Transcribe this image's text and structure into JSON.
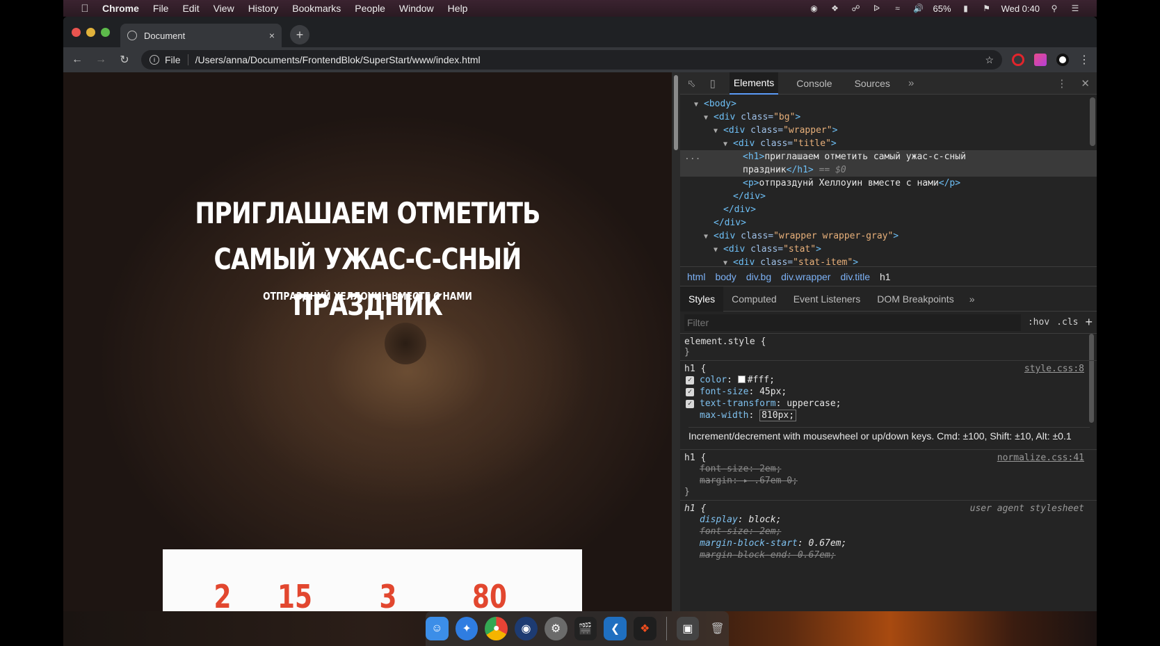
{
  "menubar": {
    "items": [
      "Chrome",
      "File",
      "Edit",
      "View",
      "History",
      "Bookmarks",
      "People",
      "Window",
      "Help"
    ],
    "battery": "65%",
    "clock": "Wed 0:40"
  },
  "browser": {
    "tab_title": "Document",
    "tab_close": "×",
    "new_tab": "+",
    "url_scheme": "File",
    "url_path": "/Users/anna/Documents/FrontendBlok/SuperStart/www/index.html"
  },
  "page": {
    "title": "ПРИГЛАШАЕМ ОТМЕТИТЬ САМЫЙ УЖАС-С-СНЫЙ ПРАЗДНИК",
    "subtitle": "ОТПРАЗДНУЙ ХЕЛЛОУИН ВМЕСТЕ С НАМИ",
    "stats": [
      "2",
      "15",
      "3",
      "80"
    ]
  },
  "devtools": {
    "tabs": [
      "Elements",
      "Console",
      "Sources"
    ],
    "more": "»",
    "dom": {
      "l1": "<body>",
      "l2_tag": "<div ",
      "l2_attr": "class=",
      "l2_val": "\"bg\"",
      "l2_end": ">",
      "l3_val": "\"wrapper\"",
      "l4_val": "\"title\"",
      "l5a": "<h1>",
      "l5b": "приглашаем отметить самый ужас-с-сный",
      "l6a": "праздник",
      "l6b": "</h1>",
      "l6c": " == $0",
      "l7a": "<p>",
      "l7b": "отпраздунй Хеллоуин вместе с нами",
      "l7c": "</p>",
      "l8": "</div>",
      "l9": "</div>",
      "l10": "</div>",
      "l11_val": "\"wrapper wrapper-gray\"",
      "l12_val": "\"stat\"",
      "l13_val": "\"stat-item\"",
      "ellipsis": "..."
    },
    "breadcrumbs": [
      "html",
      "body",
      "div.bg",
      "div.wrapper",
      "div.title",
      "h1"
    ],
    "styles_tabs": [
      "Styles",
      "Computed",
      "Event Listeners",
      "DOM Breakpoints"
    ],
    "filter_placeholder": "Filter",
    "hov": ":hov",
    "cls": ".cls",
    "add": "+",
    "element_style": "element.style {",
    "close_brace": "}",
    "rule1": {
      "selector": "h1 {",
      "source": "style.css:8",
      "decls": [
        {
          "prop": "color",
          "val": "#fff;"
        },
        {
          "prop": "font-size",
          "val": "45px;"
        },
        {
          "prop": "text-transform",
          "val": "uppercase;"
        },
        {
          "prop": "max-width",
          "val": "810px;"
        }
      ]
    },
    "tooltip": "Increment/decrement with mousewheel or up/down keys. Cmd: ±100, Shift: ±10, Alt: ±0.1",
    "rule2": {
      "selector": "h1 {",
      "source": "normalize.css:41",
      "decls": [
        {
          "prop": "font-size",
          "val": "2em;"
        },
        {
          "prop": "margin",
          "val": ".67em 0;"
        }
      ]
    },
    "rule3": {
      "selector": "h1 {",
      "source": "user agent stylesheet",
      "decls": [
        {
          "prop": "display",
          "val": "block;"
        },
        {
          "prop": "font-size",
          "val": "2em;"
        },
        {
          "prop": "margin-block-start",
          "val": "0.67em;"
        },
        {
          "prop": "margin-block-end",
          "val": "0.67em;"
        }
      ]
    }
  },
  "colors": {
    "accent_stat": "#e2472f",
    "devtools_bg": "#242424",
    "link_blue": "#7cb1f5"
  }
}
